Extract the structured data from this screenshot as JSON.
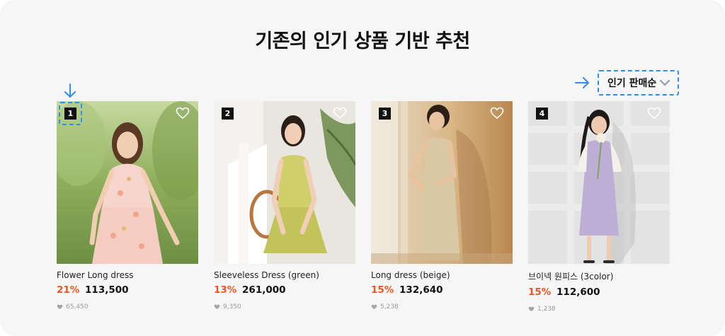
{
  "page": {
    "title": "기존의 인기 상품 기반 추천"
  },
  "sort": {
    "label": "인기 판매순"
  },
  "products": [
    {
      "rank": "1",
      "name": "Flower Long dress",
      "discount": "21%",
      "price": "113,500",
      "likes": "65,450"
    },
    {
      "rank": "2",
      "name": "Sleeveless Dress (green)",
      "discount": "13%",
      "price": "261,000",
      "likes": "9,350"
    },
    {
      "rank": "3",
      "name": "Long dress (beige)",
      "discount": "15%",
      "price": "132,640",
      "likes": "5,238"
    },
    {
      "rank": "4",
      "name": "브이넥 원피스 (3color)",
      "discount": "15%",
      "price": "112,600",
      "likes": "1,238"
    }
  ],
  "colors": {
    "accent_blue": "#2f8df0",
    "discount_orange": "#f0531f"
  }
}
